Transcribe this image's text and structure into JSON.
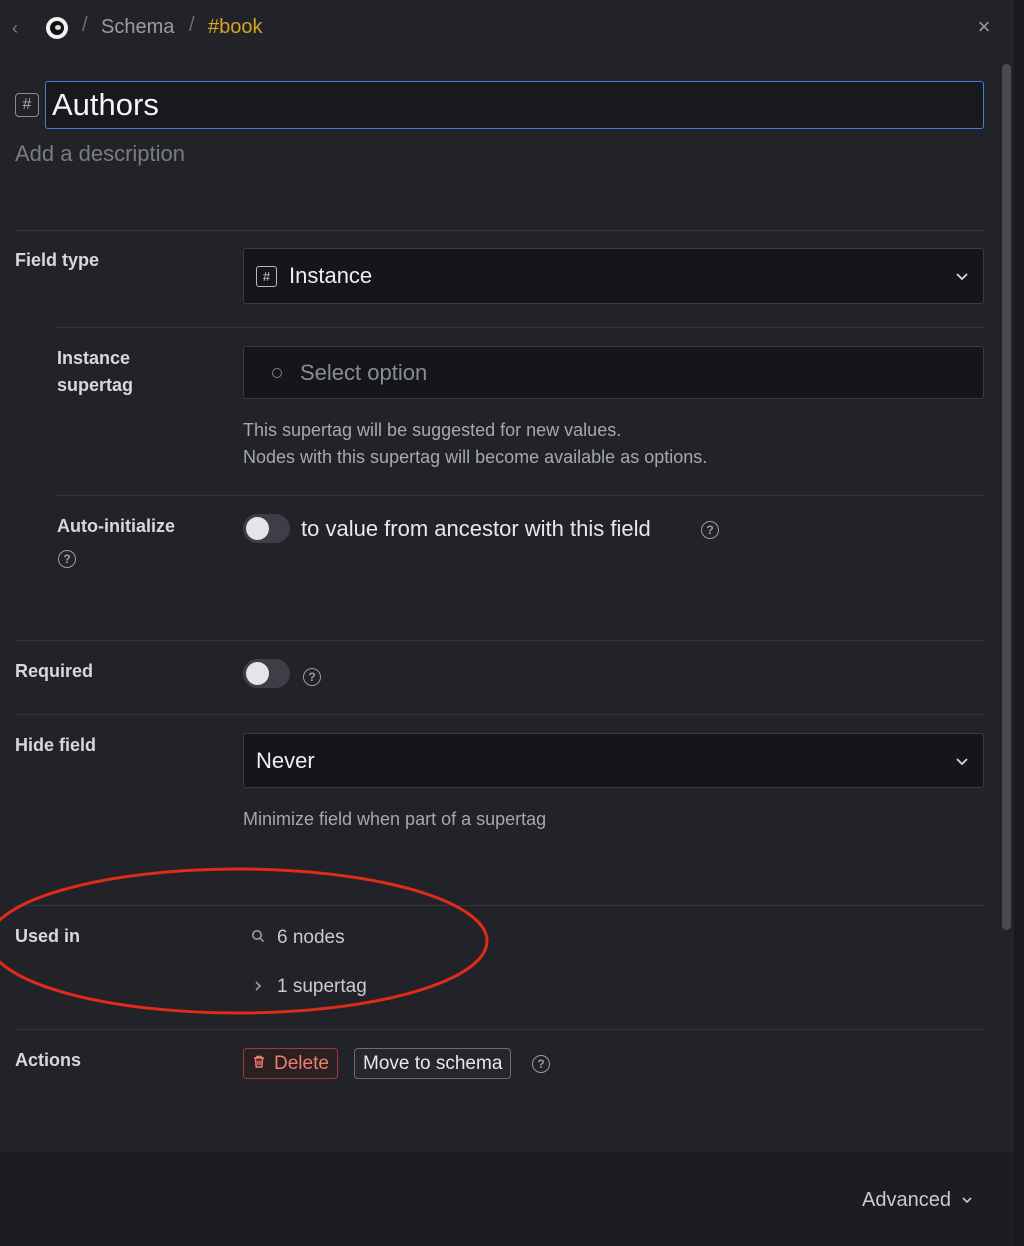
{
  "breadcrumb": {
    "back_glyph": "‹",
    "separator": "/",
    "items": [
      "Schema",
      "#book"
    ]
  },
  "close_glyph": "×",
  "title": {
    "value": "Authors",
    "hash_glyph": "#"
  },
  "description_placeholder": "Add a description",
  "field_type": {
    "label": "Field type",
    "value": "Instance",
    "hash_glyph": "#"
  },
  "instance_supertag": {
    "label_line1": "Instance",
    "label_line2": "supertag",
    "placeholder": "Select option",
    "help_line1": "This supertag will be suggested for new values.",
    "help_line2": "Nodes with this supertag will become available as options."
  },
  "auto_initialize": {
    "label": "Auto-initialize",
    "toggle_text": "to value from ancestor with this field",
    "enabled": false
  },
  "required": {
    "label": "Required",
    "enabled": false
  },
  "hide_field": {
    "label": "Hide field",
    "value": "Never",
    "help": "Minimize field when part of a supertag"
  },
  "used_in": {
    "label": "Used in",
    "nodes": "6 nodes",
    "supertags": "1 supertag"
  },
  "actions": {
    "label": "Actions",
    "delete": "Delete",
    "move": "Move to schema"
  },
  "footer": {
    "advanced": "Advanced"
  },
  "help_glyph": "?",
  "colors": {
    "accent_border": "#3f7fd6",
    "tag_color": "#d3a520",
    "delete_color": "#f17d6a",
    "annotation_red": "#e02a1a"
  }
}
